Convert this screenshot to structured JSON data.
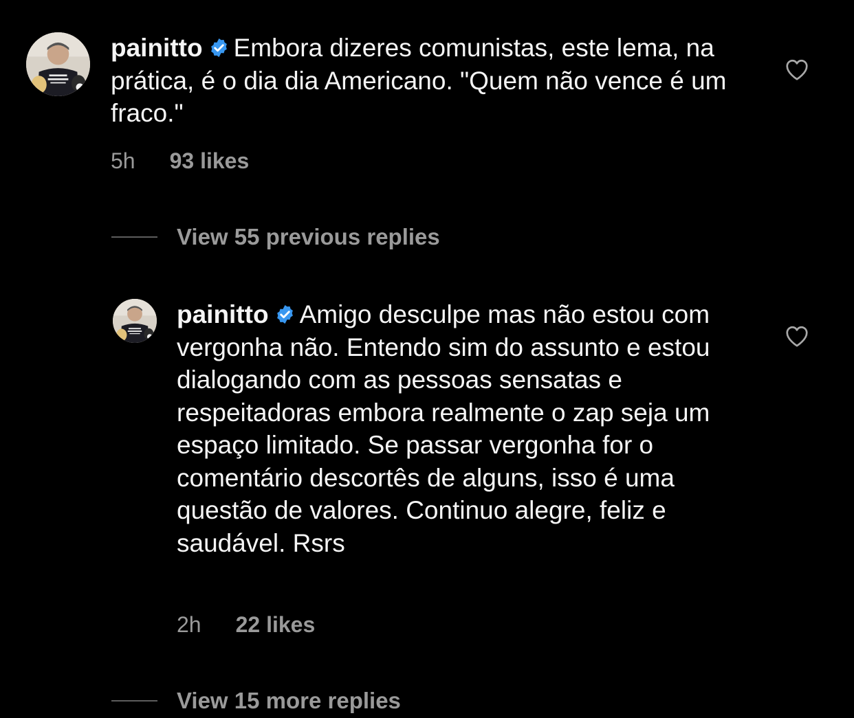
{
  "comments": [
    {
      "username": "painitto",
      "verified": true,
      "text": "Embora dizeres comunistas,  este lema, na prática,  é o dia dia Americano. \"Quem não vence é um fraco.\"",
      "time": "5h",
      "likes": "93 likes"
    },
    {
      "username": "painitto",
      "verified": true,
      "text": "Amigo desculpe mas não estou com vergonha não. Entendo sim do assunto e estou dialogando com as pessoas sensatas e respeitadoras embora realmente o zap seja um espaço limitado. Se passar vergonha for o comentário descortês de alguns, isso é uma questão de valores. Continuo alegre, feliz e saudável. Rsrs",
      "time": "2h",
      "likes": "22 likes"
    }
  ],
  "replies_toggles": {
    "previous": "View 55 previous replies",
    "more": "View 15 more replies"
  },
  "icons": {
    "verified": "verified-badge-icon",
    "like": "heart-outline-icon"
  },
  "colors": {
    "background": "#000000",
    "text": "#f5f5f5",
    "secondary_text": "#9a9a9a",
    "verified_blue": "#3897f0"
  }
}
